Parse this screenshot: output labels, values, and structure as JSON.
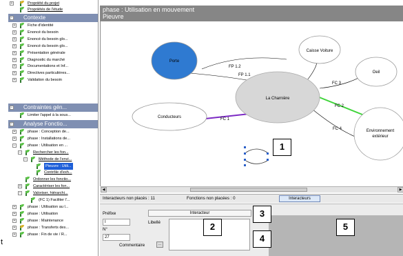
{
  "tree": {
    "top_items": [
      {
        "label": "Propriété du projet",
        "icon": "gold"
      },
      {
        "label": "Propriétés de l'étude",
        "icon": "green"
      }
    ],
    "sections": [
      {
        "label": "Contexte",
        "items": [
          "Fiche d'identité",
          "Enoncé du besoin",
          "Enoncé du besoin glo...",
          "Enoncé du besoin glo...",
          "Présentation générale",
          "Diagnostic du marché",
          "Documentations et Inf...",
          "Directives particulières...",
          "Validation du besoin"
        ]
      },
      {
        "label": "Contraintes gén...",
        "items": [
          "Limiter l'appel à la sous..."
        ]
      },
      {
        "label": "Analyse Fonctio...",
        "items": [
          "phase : Conception de...",
          "phase : Installations de...",
          "phase : Utilisation en ...",
          "Rechercher les fon...",
          "Méthode de l'envi...",
          "Pieuvre : Utili...",
          "Contrôle d'exh...",
          "Ordonner les fonctio...",
          "Caractériser les fon...",
          "Valoriser, hiérarchi...",
          "(FC 1) Faciliter l'...",
          "phase : Utilisation au l...",
          "phase : Utilisation",
          "phase : Maintenance",
          "phase : Transferts des...",
          "phase : Fin de vie / R..."
        ]
      }
    ],
    "edge_mark": "t"
  },
  "canvas": {
    "title": "phase : Utilisation en mouvement",
    "subtitle": "Pieuvre",
    "nodes": {
      "porte": "Porte",
      "caisse": "Caisse Voiture",
      "oeil": "Oeil",
      "charniere": "La Charnière",
      "conducteurs": "Conducteurs",
      "environnement_1": "Environnement",
      "environnement_2": "extérieur"
    },
    "links": {
      "fp12": "FP 1.2",
      "fp11": "FP 1.1",
      "fc3": "FC 3",
      "fc2": "FC 2",
      "fc4": "FC 4",
      "fc1": "FC 1"
    },
    "colors": {
      "porte_fill": "#2f7ad1",
      "fc1_link": "#7c2ac4",
      "fc2_link": "#3fd43a",
      "node_fill": "#d7d7d7"
    }
  },
  "status": {
    "interacteurs_non_places": "Interacteurs non placés : 11",
    "fonctions_non_placees": "Fonctions non placées : 0",
    "button": "Interacteurs"
  },
  "props": {
    "prefixe_label": "Préfixe",
    "tab_label": "Interacteur",
    "prefixe_value": "I",
    "libelle_label": "Libellé",
    "n_label": "N°",
    "n_value": "27",
    "commentaire_label": "Commentaire",
    "edit_button": "..."
  },
  "callouts": [
    "1",
    "2",
    "3",
    "4",
    "5"
  ]
}
